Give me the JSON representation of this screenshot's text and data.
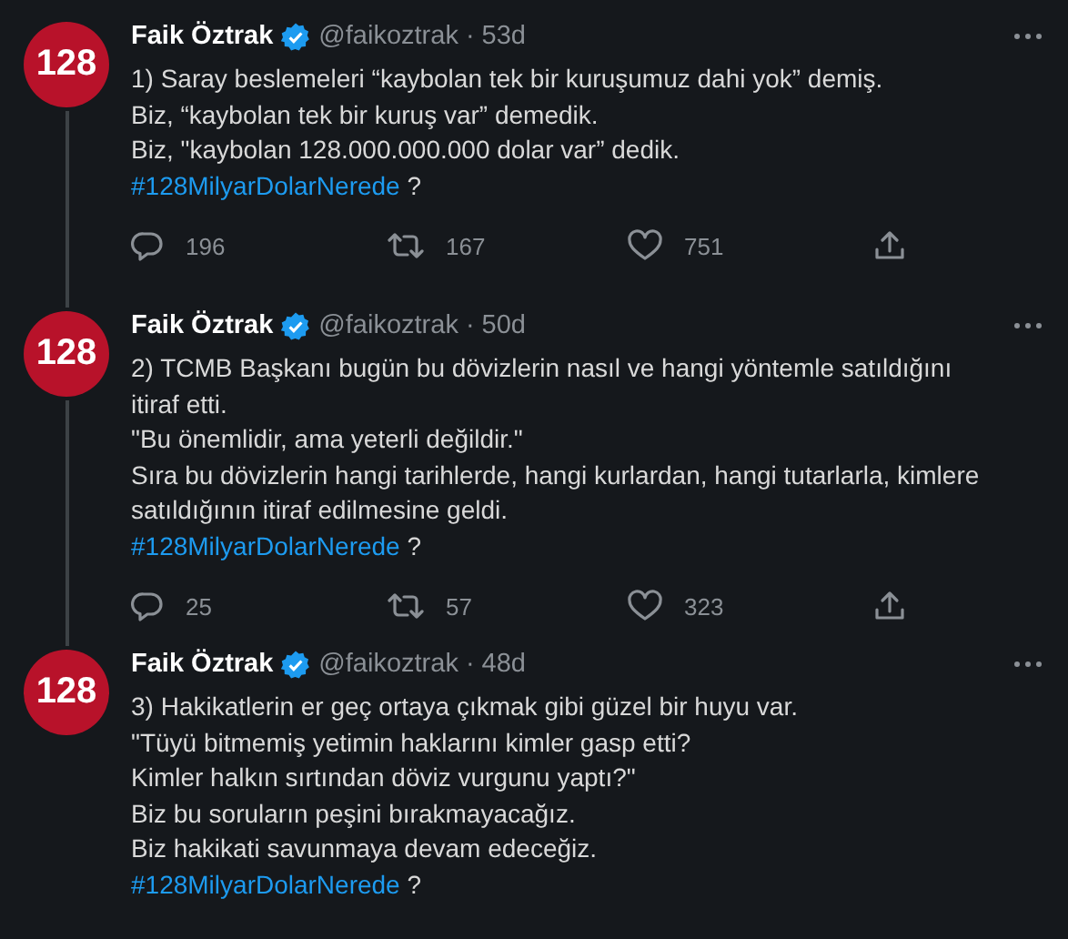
{
  "tweets": [
    {
      "avatar_text": "128",
      "name": "Faik Öztrak",
      "verified": true,
      "handle": "@faikoztrak",
      "separator": "·",
      "time": "53d",
      "connects_below": true,
      "lines": [
        "1) Saray beslemeleri “kaybolan tek bir kuruşumuz dahi yok” demiş.",
        "Biz, “kaybolan tek bir kuruş var” demedik.",
        "Biz, \"kaybolan 128.000.000.000 dolar var” dedik."
      ],
      "hashtag": "#128MilyarDolarNerede",
      "hashtag_suffix": "?",
      "replies": "196",
      "retweets": "167",
      "likes": "751"
    },
    {
      "avatar_text": "128",
      "name": "Faik Öztrak",
      "verified": true,
      "handle": "@faikoztrak",
      "separator": "·",
      "time": "50d",
      "connects_below": true,
      "lines": [
        "2) TCMB Başkanı bugün bu dövizlerin nasıl ve hangi yöntemle satıldığını",
        "itiraf etti.",
        "\"Bu önemlidir, ama yeterli değildir.\"",
        "Sıra bu dövizlerin hangi tarihlerde, hangi kurlardan, hangi tutarlarla, kimlere",
        "satıldığının itiraf edilmesine geldi."
      ],
      "hashtag": "#128MilyarDolarNerede",
      "hashtag_suffix": "?",
      "replies": "25",
      "retweets": "57",
      "likes": "323"
    },
    {
      "avatar_text": "128",
      "name": "Faik Öztrak",
      "verified": true,
      "handle": "@faikoztrak",
      "separator": "·",
      "time": "48d",
      "connects_below": false,
      "lines": [
        "3) Hakikatlerin er geç ortaya çıkmak gibi güzel bir huyu var.",
        "\"Tüyü bitmemiş yetimin haklarını kimler gasp etti?",
        "Kimler halkın sırtından döviz vurgunu yaptı?\"",
        "Biz bu soruların peşini bırakmayacağız.",
        "Biz hakikati savunmaya devam edeceğiz."
      ],
      "hashtag": "#128MilyarDolarNerede",
      "hashtag_suffix": "?"
    }
  ]
}
